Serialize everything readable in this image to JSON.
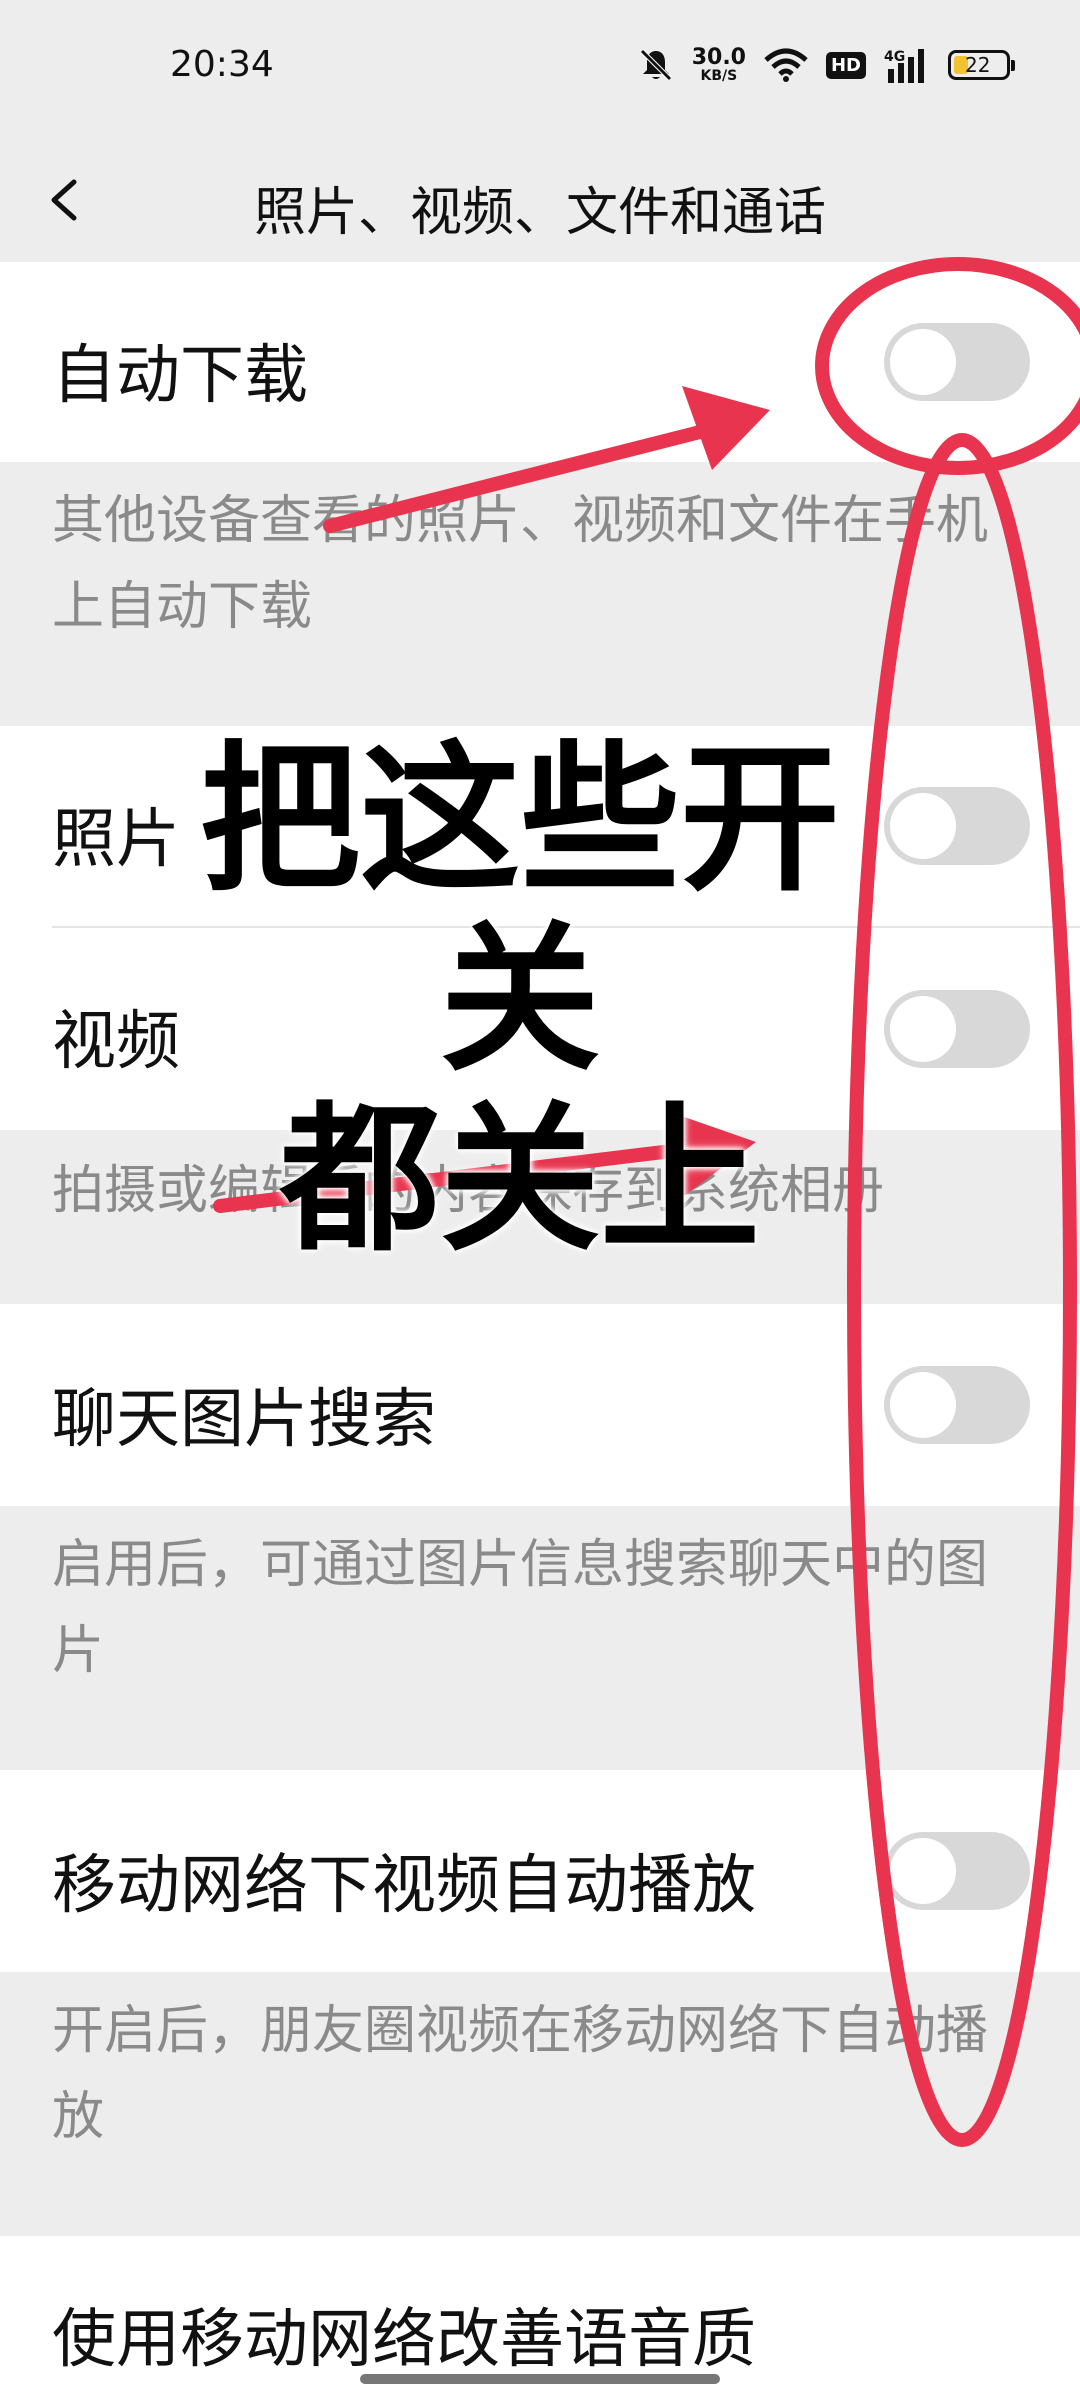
{
  "status_bar": {
    "time": "20:34",
    "network_speed": "30.0",
    "network_speed_unit": "KB/S",
    "hd_badge": "HD",
    "signal_label": "4G",
    "battery": "22",
    "icons": [
      "mute-icon",
      "wifi-icon",
      "signal-icon",
      "battery-icon"
    ]
  },
  "nav": {
    "title": "照片、视频、文件和通话",
    "back_icon": "chevron-left-icon"
  },
  "settings": {
    "auto_download": {
      "label": "自动下载",
      "enabled": false,
      "description": "其他设备查看的照片、视频和文件在手机上自动下载"
    },
    "photo": {
      "label": "照片",
      "enabled": false
    },
    "video": {
      "label": "视频",
      "enabled": false
    },
    "save_desc": "拍摄或编辑后的内容保存到系统相册",
    "chat_image_search": {
      "label": "聊天图片搜索",
      "enabled": false,
      "description": "启用后，可通过图片信息搜索聊天中的图片"
    },
    "mobile_video_autoplay": {
      "label": "移动网络下视频自动播放",
      "enabled": false,
      "description": "开启后，朋友圈视频在移动网络下自动播放"
    },
    "voice_quality": {
      "label": "使用移动网络改善语音质"
    }
  },
  "annotation": {
    "line1": "把这些开关",
    "line2": "都关上",
    "color": "#e8344e"
  },
  "colors": {
    "background": "#ededed",
    "row": "#ffffff",
    "toggle_off": "#d8d8d8",
    "description_text": "#8a8a8a"
  }
}
